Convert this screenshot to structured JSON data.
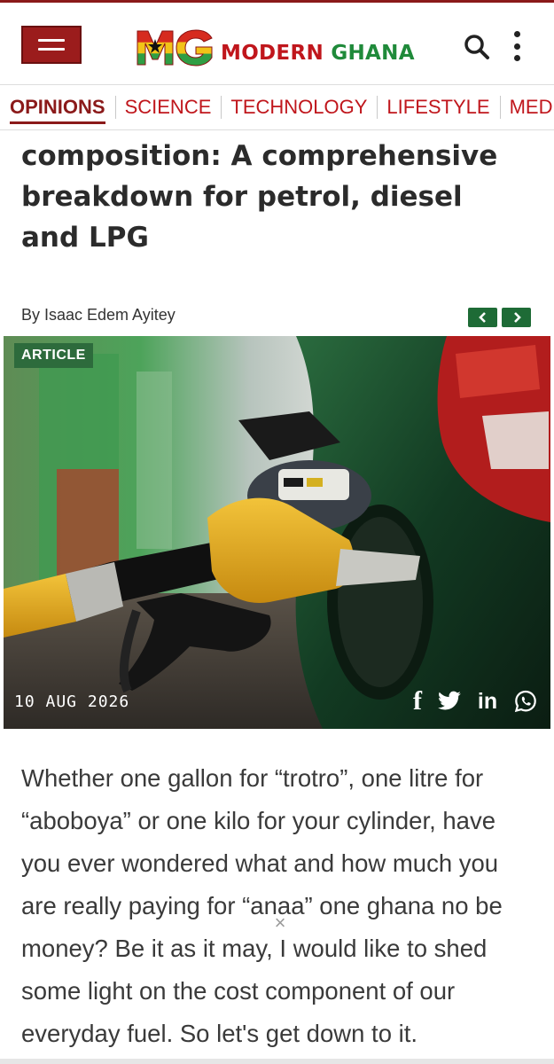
{
  "header": {
    "menu_icon": "hamburger-icon",
    "logo_mark": "MG",
    "logo_word1": "MODERN",
    "logo_word2": "GHANA",
    "search_icon": "search-icon",
    "more_icon": "more-vertical-icon",
    "brand_red": "#9b1c1c",
    "brand_green": "#1f8a3a"
  },
  "nav": {
    "items": [
      {
        "label": "OPINIONS",
        "active": true
      },
      {
        "label": "SCIENCE"
      },
      {
        "label": "TECHNOLOGY"
      },
      {
        "label": "LIFESTYLE"
      },
      {
        "label": "MEDIA"
      }
    ]
  },
  "article": {
    "title": "composition: A comprehensive breakdown for petrol, diesel and LPG",
    "byline": "By Isaac Edem Ayitey",
    "pager": {
      "prev_icon": "chevron-left-icon",
      "next_icon": "chevron-right-icon",
      "color": "#1e6b36"
    },
    "image": {
      "badge": "ARTICLE",
      "date": "10 AUG 2026",
      "share": [
        {
          "name": "facebook-icon",
          "glyph": "f"
        },
        {
          "name": "twitter-icon"
        },
        {
          "name": "linkedin-icon",
          "glyph": "in"
        },
        {
          "name": "whatsapp-icon"
        }
      ]
    },
    "body": "Whether one gallon for “trotro”, one litre for “aboboya” or one kilo for your cylinder, have you ever wondered what and how much you are really paying for “anaa” one ghana no be money? Be it as it may, I would like to shed some light on the cost component of our everyday fuel. So let's get down to it."
  },
  "overlay": {
    "close_glyph": "×"
  }
}
